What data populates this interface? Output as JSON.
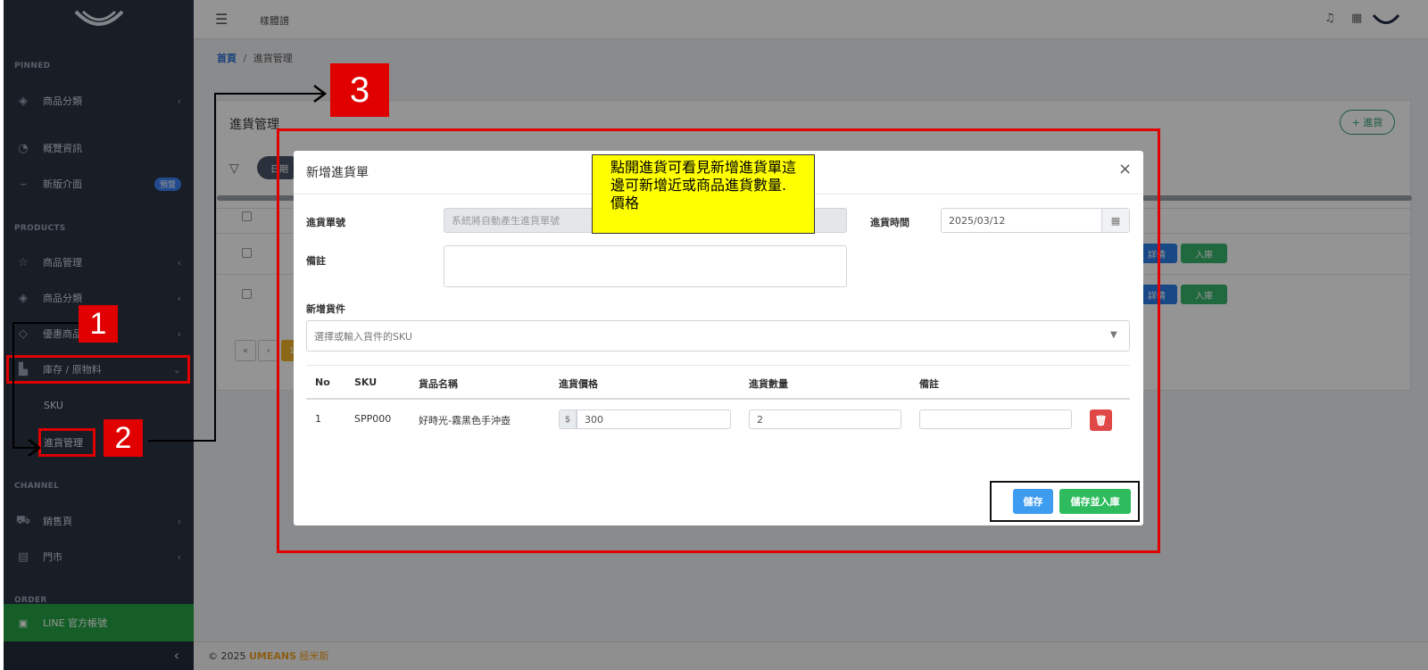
{
  "topbar": {
    "title": "樣體譜"
  },
  "sidebar": {
    "sections": {
      "pinned": "PINNED",
      "products": "PRODUCTS",
      "channel": "CHANNEL",
      "order": "ORDER"
    },
    "items": {
      "pinned_category": "商品分類",
      "overview": "概覽資訊",
      "new_ui": "新版介面",
      "new_ui_badge": "預覽",
      "product_mgmt": "商品管理",
      "category": "商品分類",
      "promo": "優惠商品",
      "inventory": "庫存 / 原物料",
      "sku": "SKU",
      "purchase": "進貨管理",
      "sales_page": "銷售頁",
      "store": "門市",
      "line": "LINE 官方帳號"
    }
  },
  "breadcrumb": {
    "home": "首頁",
    "sep": "/",
    "current": "進貨管理"
  },
  "card": {
    "title": "進貨管理",
    "add_button": "+ 進貨",
    "filter_chip": "日期",
    "page_num": "1",
    "detail_btn": "詳情",
    "stock_btn": "入庫"
  },
  "modal": {
    "title": "新增進貨單",
    "close": "×",
    "order_no_label": "進貨單號",
    "order_no_placeholder": "系統將自動產生進貨單號",
    "date_label": "進貨時間",
    "date_value": "2025/03/12",
    "note_label": "備註",
    "add_item_label": "新增貨件",
    "sku_select_placeholder": "選擇或輸入貨件的SKU",
    "table": {
      "headers": [
        "No",
        "SKU",
        "貨品名稱",
        "進貨價格",
        "進貨數量",
        "備註"
      ],
      "rows": [
        {
          "no": "1",
          "sku": "SPP000",
          "name": "好時光-霧黑色手沖壺",
          "currency": "$",
          "price": "300",
          "qty": "2",
          "note": ""
        }
      ]
    },
    "save": "儲存",
    "save_stock": "儲存並入庫"
  },
  "annotations": {
    "callout": "點開進貨可看見新增進貨單這邊可新增近或商品進貨數量.價格",
    "n1": "1",
    "n2": "2",
    "n3": "3"
  },
  "footer": {
    "copy": "© 2025",
    "brand": "UMEANS",
    "brand_cn": "極米斯"
  },
  "colors": {
    "sidebar": "#2a3242",
    "line_green": "#25a244",
    "primary": "#3d9bf0",
    "success": "#2dbb5e",
    "danger": "#e04848",
    "annotation_red": "#e00000",
    "callout_yellow": "#ffff00"
  }
}
